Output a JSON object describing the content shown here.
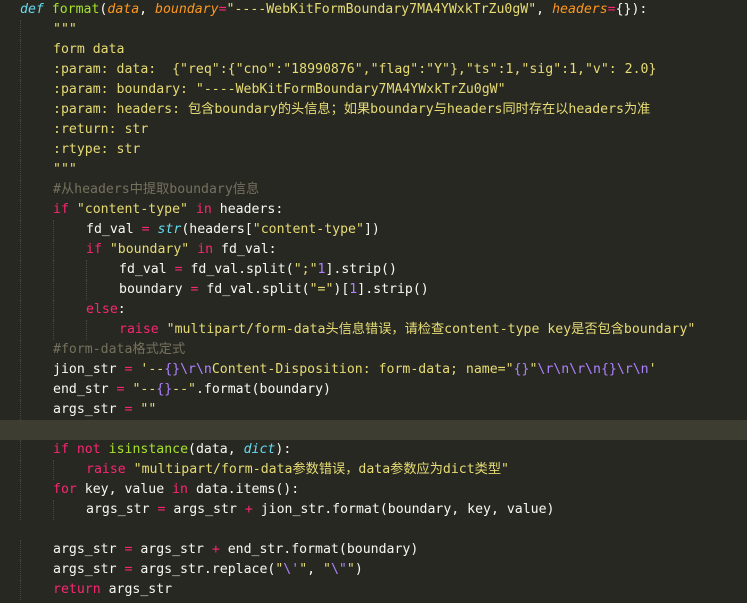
{
  "editor": {
    "theme_colors": {
      "background": "#272822",
      "text": "#f8f8f2",
      "keyword": "#f92672",
      "function": "#a6e22e",
      "parameter": "#fd971f",
      "string": "#e6db74",
      "builtin": "#66d9ef",
      "escape": "#ae81ff",
      "comment": "#75715e",
      "current_line": "#3e3d32"
    },
    "lines": [
      {
        "indent": 0,
        "tokens": [
          [
            "def",
            "def"
          ],
          [
            "",
            " "
          ],
          [
            "fn",
            "format"
          ],
          [
            "",
            "("
          ],
          [
            "pa",
            "data"
          ],
          [
            "",
            ", "
          ],
          [
            "pa",
            "boundary"
          ],
          [
            "kw",
            "="
          ],
          [
            "str",
            "\"----WebKitFormBoundary7MA4YWxkTrZu0gW\""
          ],
          [
            "",
            ", "
          ],
          [
            "pa",
            "headers"
          ],
          [
            "kw",
            "="
          ],
          [
            "",
            "{}):"
          ]
        ]
      },
      {
        "indent": 1,
        "tokens": [
          [
            "str",
            "\"\"\""
          ]
        ]
      },
      {
        "indent": 1,
        "tokens": [
          [
            "str",
            "form data"
          ]
        ]
      },
      {
        "indent": 1,
        "tokens": [
          [
            "str",
            ":param: data:  {\"req\":{\"cno\":\"18990876\",\"flag\":\"Y\"},\"ts\":1,\"sig\":1,\"v\": 2.0}"
          ]
        ]
      },
      {
        "indent": 1,
        "tokens": [
          [
            "str",
            ":param: boundary: \"----WebKitFormBoundary7MA4YWxkTrZu0gW\""
          ]
        ]
      },
      {
        "indent": 1,
        "tokens": [
          [
            "str",
            ":param: headers: 包含boundary的头信息；如果boundary与headers同时存在以headers为准"
          ]
        ]
      },
      {
        "indent": 1,
        "tokens": [
          [
            "str",
            ":return: str"
          ]
        ]
      },
      {
        "indent": 1,
        "tokens": [
          [
            "str",
            ":rtype: str"
          ]
        ]
      },
      {
        "indent": 1,
        "tokens": [
          [
            "str",
            "\"\"\""
          ]
        ]
      },
      {
        "indent": 1,
        "tokens": [
          [
            "cm",
            "#从headers中提取boundary信息"
          ]
        ]
      },
      {
        "indent": 1,
        "tokens": [
          [
            "kw",
            "if"
          ],
          [
            "",
            " "
          ],
          [
            "str",
            "\"content-type\""
          ],
          [
            "",
            " "
          ],
          [
            "kw",
            "in"
          ],
          [
            "",
            " headers:"
          ]
        ]
      },
      {
        "indent": 2,
        "tokens": [
          [
            "",
            "fd_val "
          ],
          [
            "kw",
            "="
          ],
          [
            "",
            " "
          ],
          [
            "bi",
            "str"
          ],
          [
            "",
            "(headers["
          ],
          [
            "str",
            "\"content-type\""
          ],
          [
            "",
            "])"
          ]
        ]
      },
      {
        "indent": 2,
        "tokens": [
          [
            "kw",
            "if"
          ],
          [
            "",
            " "
          ],
          [
            "str",
            "\"boundary\""
          ],
          [
            "",
            " "
          ],
          [
            "kw",
            "in"
          ],
          [
            "",
            " fd_val:"
          ]
        ]
      },
      {
        "indent": 3,
        "tokens": [
          [
            "",
            "fd_val "
          ],
          [
            "kw",
            "="
          ],
          [
            "",
            " fd_val.split("
          ],
          [
            "str",
            "\";\""
          ],
          [
            ")["
          ],
          [
            "num",
            "1"
          ],
          [
            "",
            "].strip()"
          ]
        ]
      },
      {
        "indent": 3,
        "tokens": [
          [
            "",
            "boundary "
          ],
          [
            "kw",
            "="
          ],
          [
            "",
            " fd_val.split("
          ],
          [
            "str",
            "\"=\""
          ],
          [
            "",
            ")["
          ],
          [
            "num",
            "1"
          ],
          [
            "",
            "].strip()"
          ]
        ]
      },
      {
        "indent": 2,
        "tokens": [
          [
            "kw",
            "else"
          ],
          [
            "",
            ":"
          ]
        ]
      },
      {
        "indent": 3,
        "tokens": [
          [
            "kw",
            "raise"
          ],
          [
            "",
            " "
          ],
          [
            "str",
            "\"multipart/form-data头信息错误，请检查content-type key是否包含boundary\""
          ]
        ]
      },
      {
        "indent": 1,
        "tokens": [
          [
            "cm",
            "#form-data格式定式"
          ]
        ]
      },
      {
        "indent": 1,
        "tokens": [
          [
            "",
            "jion_str "
          ],
          [
            "kw",
            "="
          ],
          [
            "",
            " "
          ],
          [
            "str",
            "'--"
          ],
          [
            "esc",
            "{}"
          ],
          [
            "esc",
            "\\r\\n"
          ],
          [
            "str",
            "Content-Disposition: form-data; name=\""
          ],
          [
            "esc",
            "{}"
          ],
          [
            "str",
            "\""
          ],
          [
            "esc",
            "\\r\\n\\r\\n"
          ],
          [
            "esc",
            "{}"
          ],
          [
            "esc",
            "\\r\\n"
          ],
          [
            "str",
            "'"
          ]
        ]
      },
      {
        "indent": 1,
        "tokens": [
          [
            "",
            "end_str "
          ],
          [
            "kw",
            "="
          ],
          [
            "",
            " "
          ],
          [
            "str",
            "\"--"
          ],
          [
            "esc",
            "{}"
          ],
          [
            "str",
            "--\""
          ],
          [
            "",
            ".format(boundary)"
          ]
        ]
      },
      {
        "indent": 1,
        "tokens": [
          [
            "",
            "args_str "
          ],
          [
            "kw",
            "="
          ],
          [
            "",
            " "
          ],
          [
            "str",
            "\"\""
          ]
        ]
      },
      {
        "indent": 0,
        "current": true,
        "tokens": []
      },
      {
        "indent": 1,
        "tokens": [
          [
            "kw",
            "if"
          ],
          [
            "",
            " "
          ],
          [
            "kw",
            "not"
          ],
          [
            "",
            " "
          ],
          [
            "fn",
            "isinstance"
          ],
          [
            "",
            "(data, "
          ],
          [
            "bi",
            "dict"
          ],
          [
            "",
            "):"
          ]
        ]
      },
      {
        "indent": 2,
        "tokens": [
          [
            "kw",
            "raise"
          ],
          [
            "",
            " "
          ],
          [
            "str",
            "\"multipart/form-data参数错误，data参数应为dict类型\""
          ]
        ]
      },
      {
        "indent": 1,
        "tokens": [
          [
            "kw",
            "for"
          ],
          [
            "",
            " key, value "
          ],
          [
            "kw",
            "in"
          ],
          [
            "",
            " data.items():"
          ]
        ]
      },
      {
        "indent": 2,
        "tokens": [
          [
            "",
            "args_str "
          ],
          [
            "kw",
            "="
          ],
          [
            "",
            " args_str "
          ],
          [
            "kw",
            "+"
          ],
          [
            "",
            " jion_str.format(boundary, key, value)"
          ]
        ]
      },
      {
        "indent": 0,
        "tokens": []
      },
      {
        "indent": 1,
        "tokens": [
          [
            "",
            "args_str "
          ],
          [
            "kw",
            "="
          ],
          [
            "",
            " args_str "
          ],
          [
            "kw",
            "+"
          ],
          [
            "",
            " end_str.format(boundary)"
          ]
        ]
      },
      {
        "indent": 1,
        "tokens": [
          [
            "",
            "args_str "
          ],
          [
            "kw",
            "="
          ],
          [
            "",
            " args_str.replace("
          ],
          [
            "str",
            "\""
          ],
          [
            "esc",
            "\\'"
          ],
          [
            "str",
            "\""
          ],
          [
            "",
            ", "
          ],
          [
            "str",
            "\""
          ],
          [
            "esc",
            "\\\""
          ],
          [
            "str",
            "\""
          ],
          [
            "",
            ")"
          ]
        ]
      },
      {
        "indent": 1,
        "tokens": [
          [
            "kw",
            "return"
          ],
          [
            "",
            " args_str"
          ]
        ]
      }
    ]
  }
}
